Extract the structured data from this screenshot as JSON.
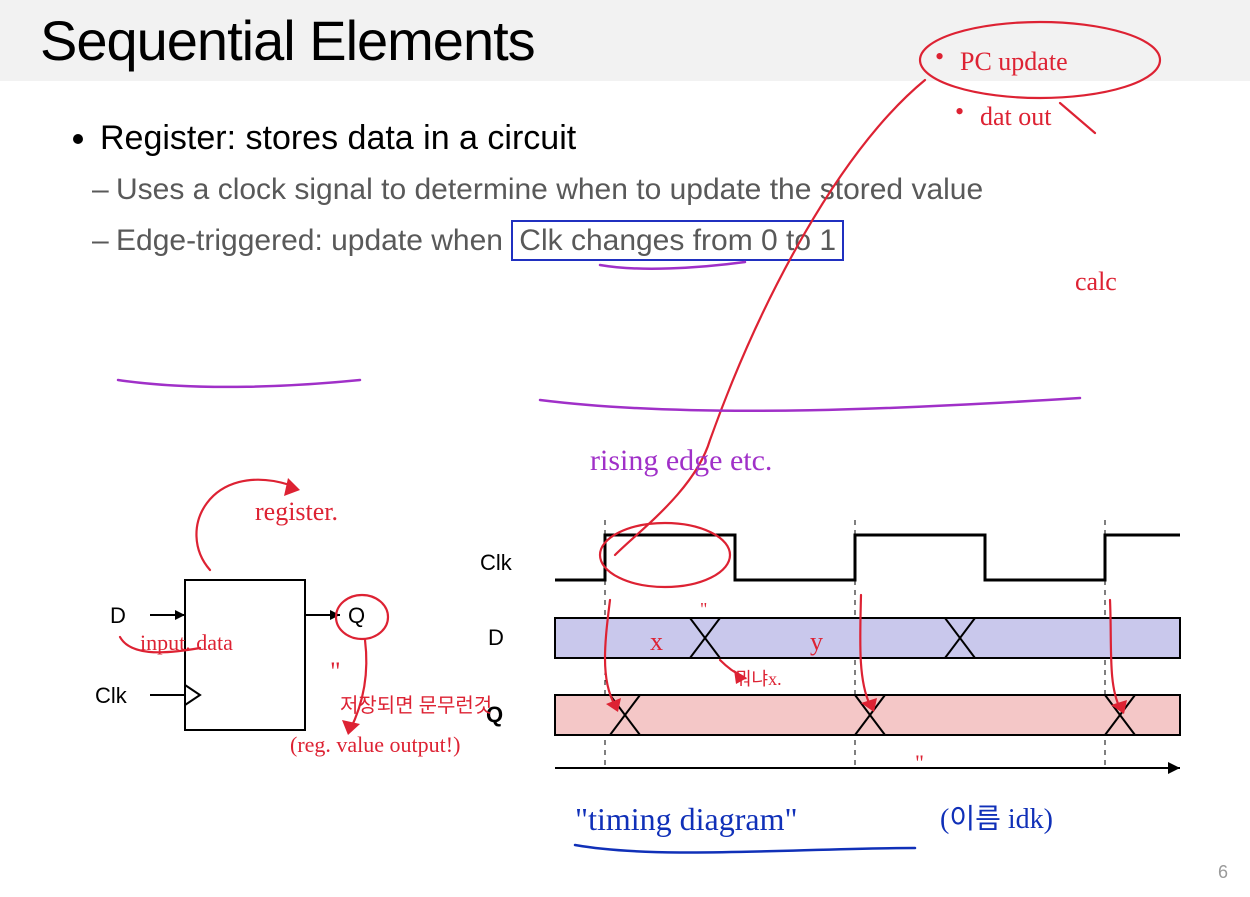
{
  "title": "Sequential Elements",
  "bullets": {
    "main": "Register: stores data in a circuit",
    "sub1": "Uses a clock signal to determine when to update the stored value",
    "sub2_pre": "Edge-triggered: update when ",
    "sub2_box": "Clk changes from 0 to 1"
  },
  "page_number": "6",
  "register_diagram": {
    "D": "D",
    "Clk": "Clk",
    "Q": "Q"
  },
  "timing_diagram": {
    "rows": {
      "clk": "Clk",
      "d": "D",
      "q": "Q"
    }
  },
  "annotations": {
    "pc_update": "PC update",
    "dat_out": "dat out",
    "calc": "calc",
    "rising_edge": "rising edge etc.",
    "register": "register.",
    "input_data": "input. data",
    "reg_value_output": "(reg. value output!)",
    "korean_note": "저장되면 문무런것",
    "x": "x",
    "y": "y",
    "qxnote": "뭐냐x.",
    "quote": "\"",
    "timing_diagram": "\"timing diagram\"",
    "idk": "(이름 idk)",
    "tick1": "\"",
    "tick2": "\""
  }
}
